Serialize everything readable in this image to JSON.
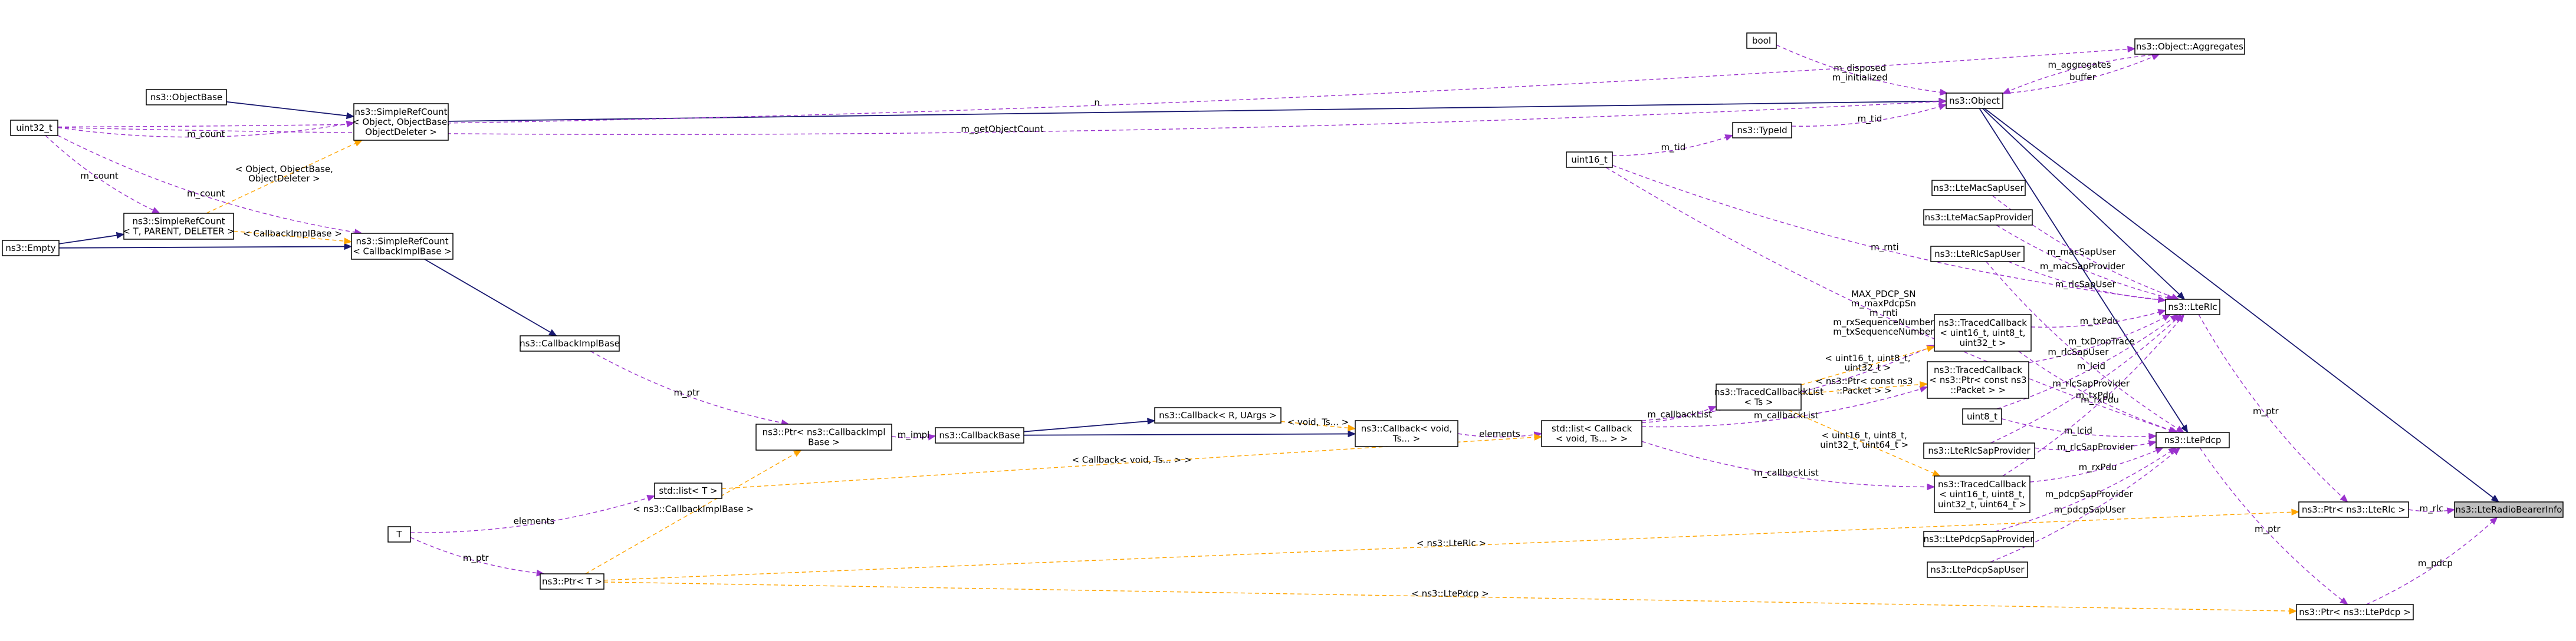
{
  "diagram": {
    "highlighted_class": "ns3::LteRadioBearerInfo",
    "nodes": [
      {
        "id": "uint32_t",
        "lines": [
          "uint32_t"
        ]
      },
      {
        "id": "Empty",
        "lines": [
          "ns3::Empty"
        ]
      },
      {
        "id": "ObjectBase",
        "lines": [
          "ns3::ObjectBase"
        ]
      },
      {
        "id": "SRC_Object",
        "lines": [
          "ns3::SimpleRefCount",
          "< Object, ObjectBase,",
          "ObjectDeleter >"
        ]
      },
      {
        "id": "SRC_T",
        "lines": [
          "ns3::SimpleRefCount",
          "< T, PARENT, DELETER >"
        ]
      },
      {
        "id": "SRC_CIB",
        "lines": [
          "ns3::SimpleRefCount",
          "< CallbackImplBase >"
        ]
      },
      {
        "id": "CallbackImplBase",
        "lines": [
          "ns3::CallbackImplBase"
        ]
      },
      {
        "id": "PtrCIB",
        "lines": [
          "ns3::Ptr< ns3::CallbackImpl",
          "Base >"
        ]
      },
      {
        "id": "CallbackBase",
        "lines": [
          "ns3::CallbackBase"
        ]
      },
      {
        "id": "CallbackRU",
        "lines": [
          "ns3::Callback< R, UArgs >"
        ]
      },
      {
        "id": "CallbackVoid",
        "lines": [
          "ns3::Callback< void,",
          "Ts... >"
        ]
      },
      {
        "id": "ListT",
        "lines": [
          "std::list< T >"
        ]
      },
      {
        "id": "T",
        "lines": [
          "T"
        ]
      },
      {
        "id": "PtrT",
        "lines": [
          "ns3::Ptr< T >"
        ]
      },
      {
        "id": "ListCB",
        "lines": [
          "std::list< Callback",
          "< void, Ts... > >"
        ]
      },
      {
        "id": "TracedCbTs",
        "lines": [
          "ns3::TracedCallback",
          "< Ts >"
        ]
      },
      {
        "id": "Bool",
        "lines": [
          "bool"
        ]
      },
      {
        "id": "TypeId",
        "lines": [
          "ns3::TypeId"
        ]
      },
      {
        "id": "Uint16",
        "lines": [
          "uint16_t"
        ]
      },
      {
        "id": "Object",
        "lines": [
          "ns3::Object"
        ]
      },
      {
        "id": "Aggregates",
        "lines": [
          "ns3::Object::Aggregates"
        ]
      },
      {
        "id": "MacSapUser",
        "lines": [
          "ns3::LteMacSapUser"
        ]
      },
      {
        "id": "MacSapProvider",
        "lines": [
          "ns3::LteMacSapProvider"
        ]
      },
      {
        "id": "RlcSapUser",
        "lines": [
          "ns3::LteRlcSapUser"
        ]
      },
      {
        "id": "TC1",
        "lines": [
          "ns3::TracedCallback",
          "< uint16_t, uint8_t,",
          "uint32_t >"
        ]
      },
      {
        "id": "TC2",
        "lines": [
          "ns3::TracedCallback",
          "< ns3::Ptr< const ns3",
          "::Packet > >"
        ]
      },
      {
        "id": "Uint8",
        "lines": [
          "uint8_t"
        ]
      },
      {
        "id": "RlcSapProvider",
        "lines": [
          "ns3::LteRlcSapProvider"
        ]
      },
      {
        "id": "TC3",
        "lines": [
          "ns3::TracedCallback",
          "< uint16_t, uint8_t,",
          "uint32_t, uint64_t >"
        ]
      },
      {
        "id": "PdcpSapProvider",
        "lines": [
          "ns3::LtePdcpSapProvider"
        ]
      },
      {
        "id": "PdcpSapUser",
        "lines": [
          "ns3::LtePdcpSapUser"
        ]
      },
      {
        "id": "LteRlc",
        "lines": [
          "ns3::LteRlc"
        ]
      },
      {
        "id": "LtePdcp",
        "lines": [
          "ns3::LtePdcp"
        ]
      },
      {
        "id": "PtrRlc",
        "lines": [
          "ns3::Ptr< ns3::LteRlc >"
        ]
      },
      {
        "id": "PtrPdcp",
        "lines": [
          "ns3::Ptr< ns3::LtePdcp >"
        ]
      },
      {
        "id": "RBInfo",
        "lines": [
          "ns3::LteRadioBearerInfo"
        ]
      }
    ],
    "edges": [
      {
        "type": "inheritance",
        "from": "Object",
        "to": "RBInfo"
      },
      {
        "type": "inheritance",
        "from": "SRC_Object",
        "to": "Object"
      },
      {
        "type": "inheritance",
        "from": "ObjectBase",
        "to": "SRC_Object"
      },
      {
        "type": "inheritance",
        "from": "Empty",
        "to": "SRC_T"
      },
      {
        "type": "inheritance",
        "from": "Empty",
        "to": "SRC_CIB"
      },
      {
        "type": "inheritance",
        "from": "SRC_CIB",
        "to": "CallbackImplBase"
      },
      {
        "type": "inheritance",
        "from": "CallbackBase",
        "to": "CallbackRU"
      },
      {
        "type": "inheritance",
        "from": "CallbackBase",
        "to": "CallbackVoid"
      },
      {
        "type": "inheritance",
        "from": "Object",
        "to": "LteRlc"
      },
      {
        "type": "inheritance",
        "from": "Object",
        "to": "LtePdcp"
      },
      {
        "type": "usage",
        "from": "uint32_t",
        "to": "Aggregates",
        "label": "n"
      },
      {
        "type": "usage",
        "from": "uint32_t",
        "to": "Object",
        "label": "m_getObjectCount"
      },
      {
        "type": "usage",
        "from": "uint32_t",
        "to": "SRC_Object",
        "label": "m_count"
      },
      {
        "type": "usage",
        "from": "uint32_t",
        "to": "SRC_CIB",
        "label": "m_count"
      },
      {
        "type": "usage",
        "from": "uint32_t",
        "to": "SRC_T",
        "label": "m_count"
      },
      {
        "type": "usage",
        "from": "Bool",
        "to": "Object",
        "label": "m_disposed\nm_initialized"
      },
      {
        "type": "usage",
        "from": "Aggregates",
        "to": "Object",
        "label": "m_aggregates"
      },
      {
        "type": "usage",
        "from": "Object",
        "to": "Aggregates",
        "label": "buffer"
      },
      {
        "type": "usage",
        "from": "TypeId",
        "to": "Object",
        "label": "m_tid"
      },
      {
        "type": "usage",
        "from": "Uint16",
        "to": "TypeId",
        "label": "m_tid"
      },
      {
        "type": "usage",
        "from": "Uint16",
        "to": "LteRlc",
        "label": "m_rnti"
      },
      {
        "type": "usage",
        "from": "Uint16",
        "to": "LtePdcp",
        "label": "MAX_PDCP_SN\nm_maxPdcpSn\nm_rnti\nm_rxSequenceNumber\nm_txSequenceNumber"
      },
      {
        "type": "usage",
        "from": "MacSapUser",
        "to": "LteRlc",
        "label": "m_macSapUser"
      },
      {
        "type": "usage",
        "from": "MacSapProvider",
        "to": "LteRlc",
        "label": "m_macSapProvider"
      },
      {
        "type": "usage",
        "from": "RlcSapUser",
        "to": "LteRlc",
        "label": "m_rlcSapUser"
      },
      {
        "type": "usage",
        "from": "RlcSapUser",
        "to": "LtePdcp",
        "label": "m_rlcSapUser"
      },
      {
        "type": "usage",
        "from": "TC1",
        "to": "LteRlc",
        "label": "m_txPdu"
      },
      {
        "type": "usage",
        "from": "TC1",
        "to": "LtePdcp",
        "label": "m_txPdu"
      },
      {
        "type": "usage",
        "from": "TC2",
        "to": "LteRlc",
        "label": "m_txDropTrace"
      },
      {
        "type": "usage",
        "from": "Uint8",
        "to": "LteRlc",
        "label": "m_lcid"
      },
      {
        "type": "usage",
        "from": "Uint8",
        "to": "LtePdcp",
        "label": "m_lcid"
      },
      {
        "type": "usage",
        "from": "RlcSapProvider",
        "to": "LteRlc",
        "label": "m_rlcSapProvider"
      },
      {
        "type": "usage",
        "from": "RlcSapProvider",
        "to": "LtePdcp",
        "label": "m_rlcSapProvider"
      },
      {
        "type": "usage",
        "from": "TC3",
        "to": "LteRlc",
        "label": "m_rxPdu"
      },
      {
        "type": "usage",
        "from": "TC3",
        "to": "LtePdcp",
        "label": "m_rxPdu"
      },
      {
        "type": "usage",
        "from": "PdcpSapProvider",
        "to": "LtePdcp",
        "label": "m_pdcpSapProvider"
      },
      {
        "type": "usage",
        "from": "PdcpSapUser",
        "to": "LtePdcp",
        "label": "m_pdcpSapUser"
      },
      {
        "type": "usage",
        "from": "ListCB",
        "to": "TC1",
        "label": "m_callbackList"
      },
      {
        "type": "usage",
        "from": "ListCB",
        "to": "TracedCbTs",
        "label": "m_callbackList"
      },
      {
        "type": "usage",
        "from": "ListCB",
        "to": "TC2",
        "label": "m_callbackList"
      },
      {
        "type": "usage",
        "from": "ListCB",
        "to": "TC3",
        "label": "m_callbackList"
      },
      {
        "type": "usage",
        "from": "CallbackVoid",
        "to": "ListCB",
        "label": "elements"
      },
      {
        "type": "usage",
        "from": "PtrCIB",
        "to": "CallbackBase",
        "label": "m_impl"
      },
      {
        "type": "usage",
        "from": "CallbackImplBase",
        "to": "PtrCIB",
        "label": "m_ptr"
      },
      {
        "type": "usage",
        "from": "T",
        "to": "ListT",
        "label": "elements"
      },
      {
        "type": "usage",
        "from": "T",
        "to": "PtrT",
        "label": "m_ptr"
      },
      {
        "type": "usage",
        "from": "LteRlc",
        "to": "PtrRlc",
        "label": "m_ptr"
      },
      {
        "type": "usage",
        "from": "LtePdcp",
        "to": "PtrPdcp",
        "label": "m_ptr"
      },
      {
        "type": "usage",
        "from": "PtrRlc",
        "to": "RBInfo",
        "label": "m_rlc"
      },
      {
        "type": "usage",
        "from": "PtrPdcp",
        "to": "RBInfo",
        "label": "m_pdcp"
      },
      {
        "type": "template",
        "from": "SRC_T",
        "to": "SRC_Object",
        "label": "< Object, ObjectBase,\nObjectDeleter >"
      },
      {
        "type": "template",
        "from": "SRC_T",
        "to": "SRC_CIB",
        "label": "< CallbackImplBase >"
      },
      {
        "type": "template",
        "from": "PtrT",
        "to": "PtrCIB",
        "label": "< ns3::CallbackImplBase >"
      },
      {
        "type": "template",
        "from": "CallbackRU",
        "to": "CallbackVoid",
        "label": "< void, Ts... >"
      },
      {
        "type": "template",
        "from": "ListT",
        "to": "ListCB",
        "label": "< Callback< void, Ts... > >"
      },
      {
        "type": "template",
        "from": "TracedCbTs",
        "to": "TC1",
        "label": "< uint16_t, uint8_t,\nuint32_t >"
      },
      {
        "type": "template",
        "from": "TracedCbTs",
        "to": "TC2",
        "label": "< ns3::Ptr< const ns3\n::Packet > >"
      },
      {
        "type": "template",
        "from": "TracedCbTs",
        "to": "TC3",
        "label": "< uint16_t, uint8_t,\nuint32_t, uint64_t >"
      },
      {
        "type": "template",
        "from": "PtrT",
        "to": "PtrRlc",
        "label": "< ns3::LteRlc >"
      },
      {
        "type": "template",
        "from": "PtrT",
        "to": "PtrPdcp",
        "label": "< ns3::LtePdcp >"
      }
    ]
  },
  "colors": {
    "inheritance": "#191970",
    "usage": "#9a32cd",
    "template": "#ffa500",
    "node_border": "#000000",
    "highlight_fill": "#bfbfbf"
  }
}
